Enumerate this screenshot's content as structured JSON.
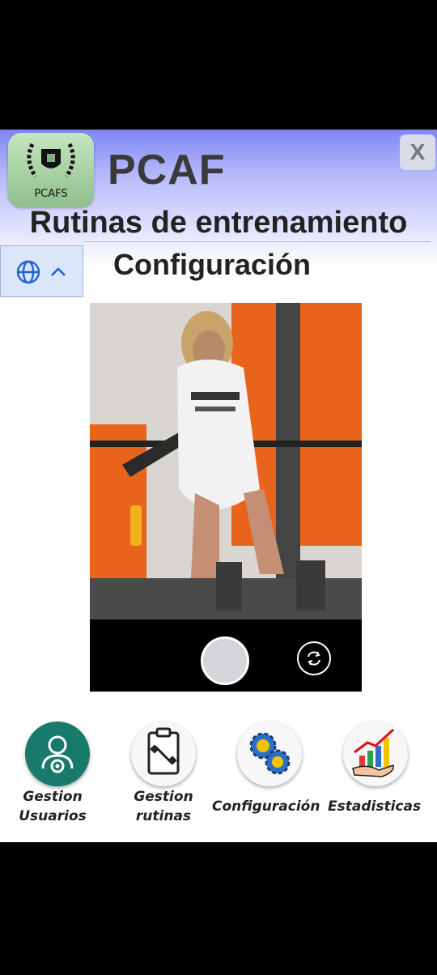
{
  "header": {
    "logo_text": "PCAFS",
    "brand": "PCAF",
    "close_label": "X",
    "title": "Rutinas de entrenamiento",
    "subtitle": "Configuración"
  },
  "language": {
    "icon": "globe-icon",
    "toggle_icon": "chevron-up-icon"
  },
  "camera": {
    "shutter_icon": "shutter-button",
    "switch_icon": "switch-camera-icon"
  },
  "nav": [
    {
      "line1": "Gestion",
      "line2": "Usuarios",
      "icon": "user-gear-icon"
    },
    {
      "line1": "Gestion",
      "line2": "rutinas",
      "icon": "clipboard-dumbbell-icon"
    },
    {
      "line1": "Configuración",
      "line2": "",
      "icon": "gears-icon"
    },
    {
      "line1": "Estadisticas",
      "line2": "",
      "icon": "chart-growth-icon"
    }
  ],
  "colors": {
    "header_accent": "#7f86f5",
    "users_icon_bg": "#177a6a",
    "photo_wall": "#e8631c"
  }
}
